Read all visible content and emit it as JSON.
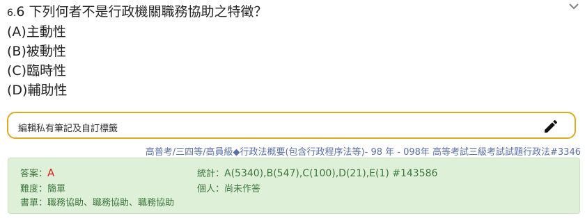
{
  "question": {
    "number": "6.",
    "title": "6 下列何者不是行政機關職務協助之特徵？",
    "options": [
      "(A)主動性",
      "(B)被動性",
      "(C)臨時性",
      "(D)輔助性"
    ]
  },
  "note": {
    "placeholder": "編輯私有筆記及自訂標籤"
  },
  "source": {
    "text": "高普考/三四等/高員級◆行政法概要(包含行政程序法等)- 98 年 - 098年 高等考試三級考試試題行政法#3346"
  },
  "info": {
    "answer_label": "答案：",
    "answer_value": "A",
    "difficulty_label": "難度：",
    "difficulty_value": "簡單",
    "booklist_label": "書單：",
    "booklist_items": [
      "職務協助",
      "職務協助",
      "職務協助"
    ],
    "separator": "、",
    "stats_label": "統計：",
    "stats_value": "A(5340),B(547),C(100),D(21),E(1) #143586",
    "personal_label": "個人：",
    "personal_value": "尚未作答"
  },
  "colors": {
    "accent_border": "#e0a81e",
    "info_bg": "#dff0d8",
    "info_text": "#3c763d",
    "answer": "#e02020",
    "source_link": "#5b6fa8"
  }
}
